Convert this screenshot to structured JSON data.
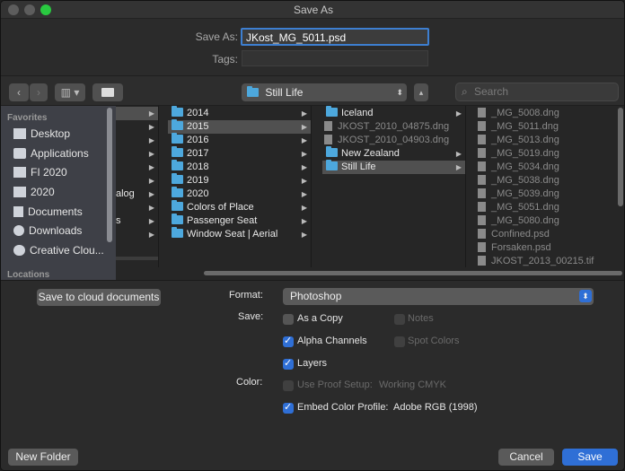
{
  "window": {
    "title": "Save As"
  },
  "save_as": {
    "label": "Save As:",
    "value": "JKost_MG_5011.psd"
  },
  "tags": {
    "label": "Tags:",
    "value": ""
  },
  "toolbar": {
    "location": "Still Life",
    "search_placeholder": "Search"
  },
  "sidebar": {
    "favorites_header": "Favorites",
    "locations_header": "Locations",
    "items": [
      {
        "label": "Desktop",
        "icon": "desktop-icon"
      },
      {
        "label": "Applications",
        "icon": "applications-icon"
      },
      {
        "label": "FI 2020",
        "icon": "folder-icon"
      },
      {
        "label": "2020",
        "icon": "folder-icon"
      },
      {
        "label": "Documents",
        "icon": "documents-icon"
      },
      {
        "label": "Downloads",
        "icon": "downloads-icon"
      },
      {
        "label": "Creative Clou...",
        "icon": "creative-cloud-icon"
      }
    ]
  },
  "columns": {
    "col0_fragments": [
      "alog",
      "s"
    ],
    "col1": [
      "2014",
      "2015",
      "2016",
      "2017",
      "2018",
      "2019",
      "2020",
      "Colors of Place",
      "Passenger Seat",
      "Window Seat | Aerial"
    ],
    "col2": [
      {
        "name": "Iceland",
        "kind": "folder"
      },
      {
        "name": "JKOST_2010_04875.dng",
        "kind": "file"
      },
      {
        "name": "JKOST_2010_04903.dng",
        "kind": "file"
      },
      {
        "name": "New Zealand",
        "kind": "folder"
      },
      {
        "name": "Still Life",
        "kind": "folder"
      }
    ],
    "col3": [
      "_MG_5008.dng",
      "_MG_5011.dng",
      "_MG_5013.dng",
      "_MG_5019.dng",
      "_MG_5034.dng",
      "_MG_5038.dng",
      "_MG_5039.dng",
      "_MG_5051.dng",
      "_MG_5080.dng",
      "Confined.psd",
      "Forsaken.psd",
      "JKOST_2013_00215.tif"
    ]
  },
  "options": {
    "save_cloud": "Save to cloud documents",
    "format_label": "Format:",
    "format_value": "Photoshop",
    "save_label": "Save:",
    "as_copy": "As a Copy",
    "notes": "Notes",
    "alpha_channels": "Alpha Channels",
    "spot_colors": "Spot Colors",
    "layers": "Layers",
    "color_label": "Color:",
    "use_proof": "Use Proof Setup:",
    "proof_value": "Working CMYK",
    "embed_profile": "Embed Color Profile:",
    "profile_value": "Adobe RGB (1998)"
  },
  "buttons": {
    "new_folder": "New Folder",
    "cancel": "Cancel",
    "save": "Save"
  },
  "colors": {
    "accent": "#2f6fd6",
    "folder": "#4da8dd"
  }
}
